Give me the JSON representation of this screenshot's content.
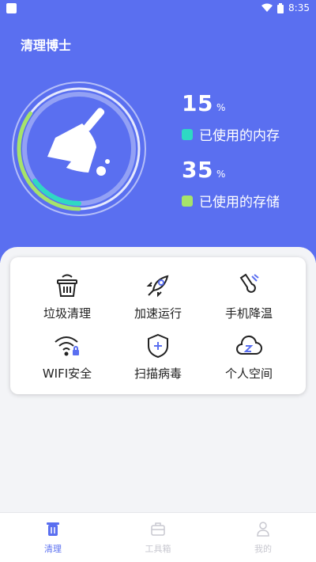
{
  "status": {
    "time": "8:35"
  },
  "app": {
    "title": "清理博士"
  },
  "memory": {
    "value": "15",
    "unit": "%",
    "label": "已使用的内存",
    "color": "#2ed9c3"
  },
  "storage": {
    "value": "35",
    "unit": "%",
    "label": "已使用的存储",
    "color": "#a6e36a"
  },
  "tools": [
    {
      "label": "垃圾清理",
      "icon": "basket-icon"
    },
    {
      "label": "加速运行",
      "icon": "rocket-icon"
    },
    {
      "label": "手机降温",
      "icon": "thermometer-icon"
    },
    {
      "label": "WIFI安全",
      "icon": "wifi-lock-icon"
    },
    {
      "label": "扫描病毒",
      "icon": "shield-plus-icon"
    },
    {
      "label": "个人空间",
      "icon": "cloud-sleep-icon"
    }
  ],
  "nav": [
    {
      "label": "清理",
      "icon": "trash-icon",
      "active": true
    },
    {
      "label": "工具箱",
      "icon": "toolbox-icon",
      "active": false
    },
    {
      "label": "我的",
      "icon": "user-icon",
      "active": false
    }
  ],
  "colors": {
    "primary": "#5a6ff0",
    "nav_active": "#5a6ff0",
    "nav_inactive": "#c8c8d0"
  }
}
